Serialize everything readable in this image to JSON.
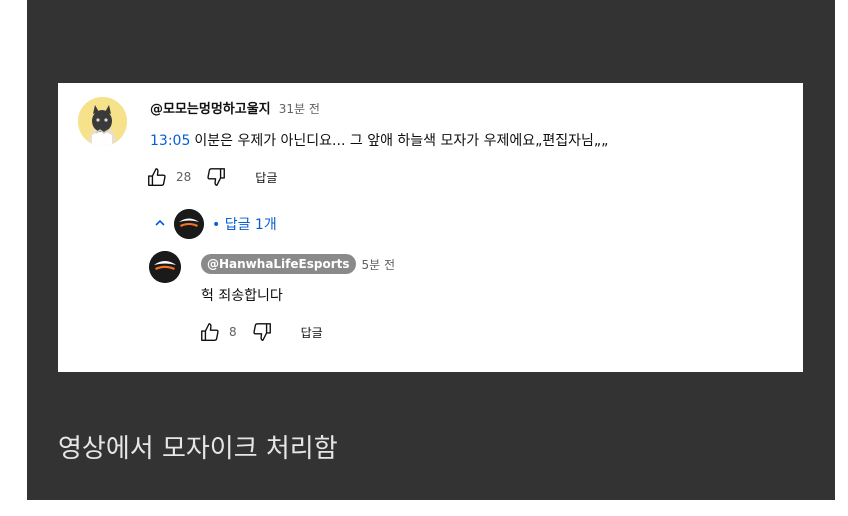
{
  "comment": {
    "author": "@모모는멍멍하고울지",
    "time": "31분 전",
    "timestamp": "13:05",
    "text": "이분은 우제가 아닌디요... 그 앞애 하늘색 모자가 우제에요„편집자님„„",
    "likes": "28",
    "reply_label": "답글"
  },
  "replies_toggle": {
    "label": "• 답글 1개"
  },
  "reply": {
    "author": "@HanwhaLifeEsports",
    "time": "5분 전",
    "text": "헉 죄송합니다",
    "likes": "8",
    "reply_label": "답글"
  },
  "caption": "영상에서 모자이크 처리함",
  "colors": {
    "panel": "#333333",
    "link": "#065fd4",
    "badge": "#8a8a8a"
  },
  "icons": [
    "cat-avatar-icon",
    "thumbs-up-icon",
    "thumbs-down-icon",
    "chevron-up-icon",
    "hle-logo-icon"
  ]
}
